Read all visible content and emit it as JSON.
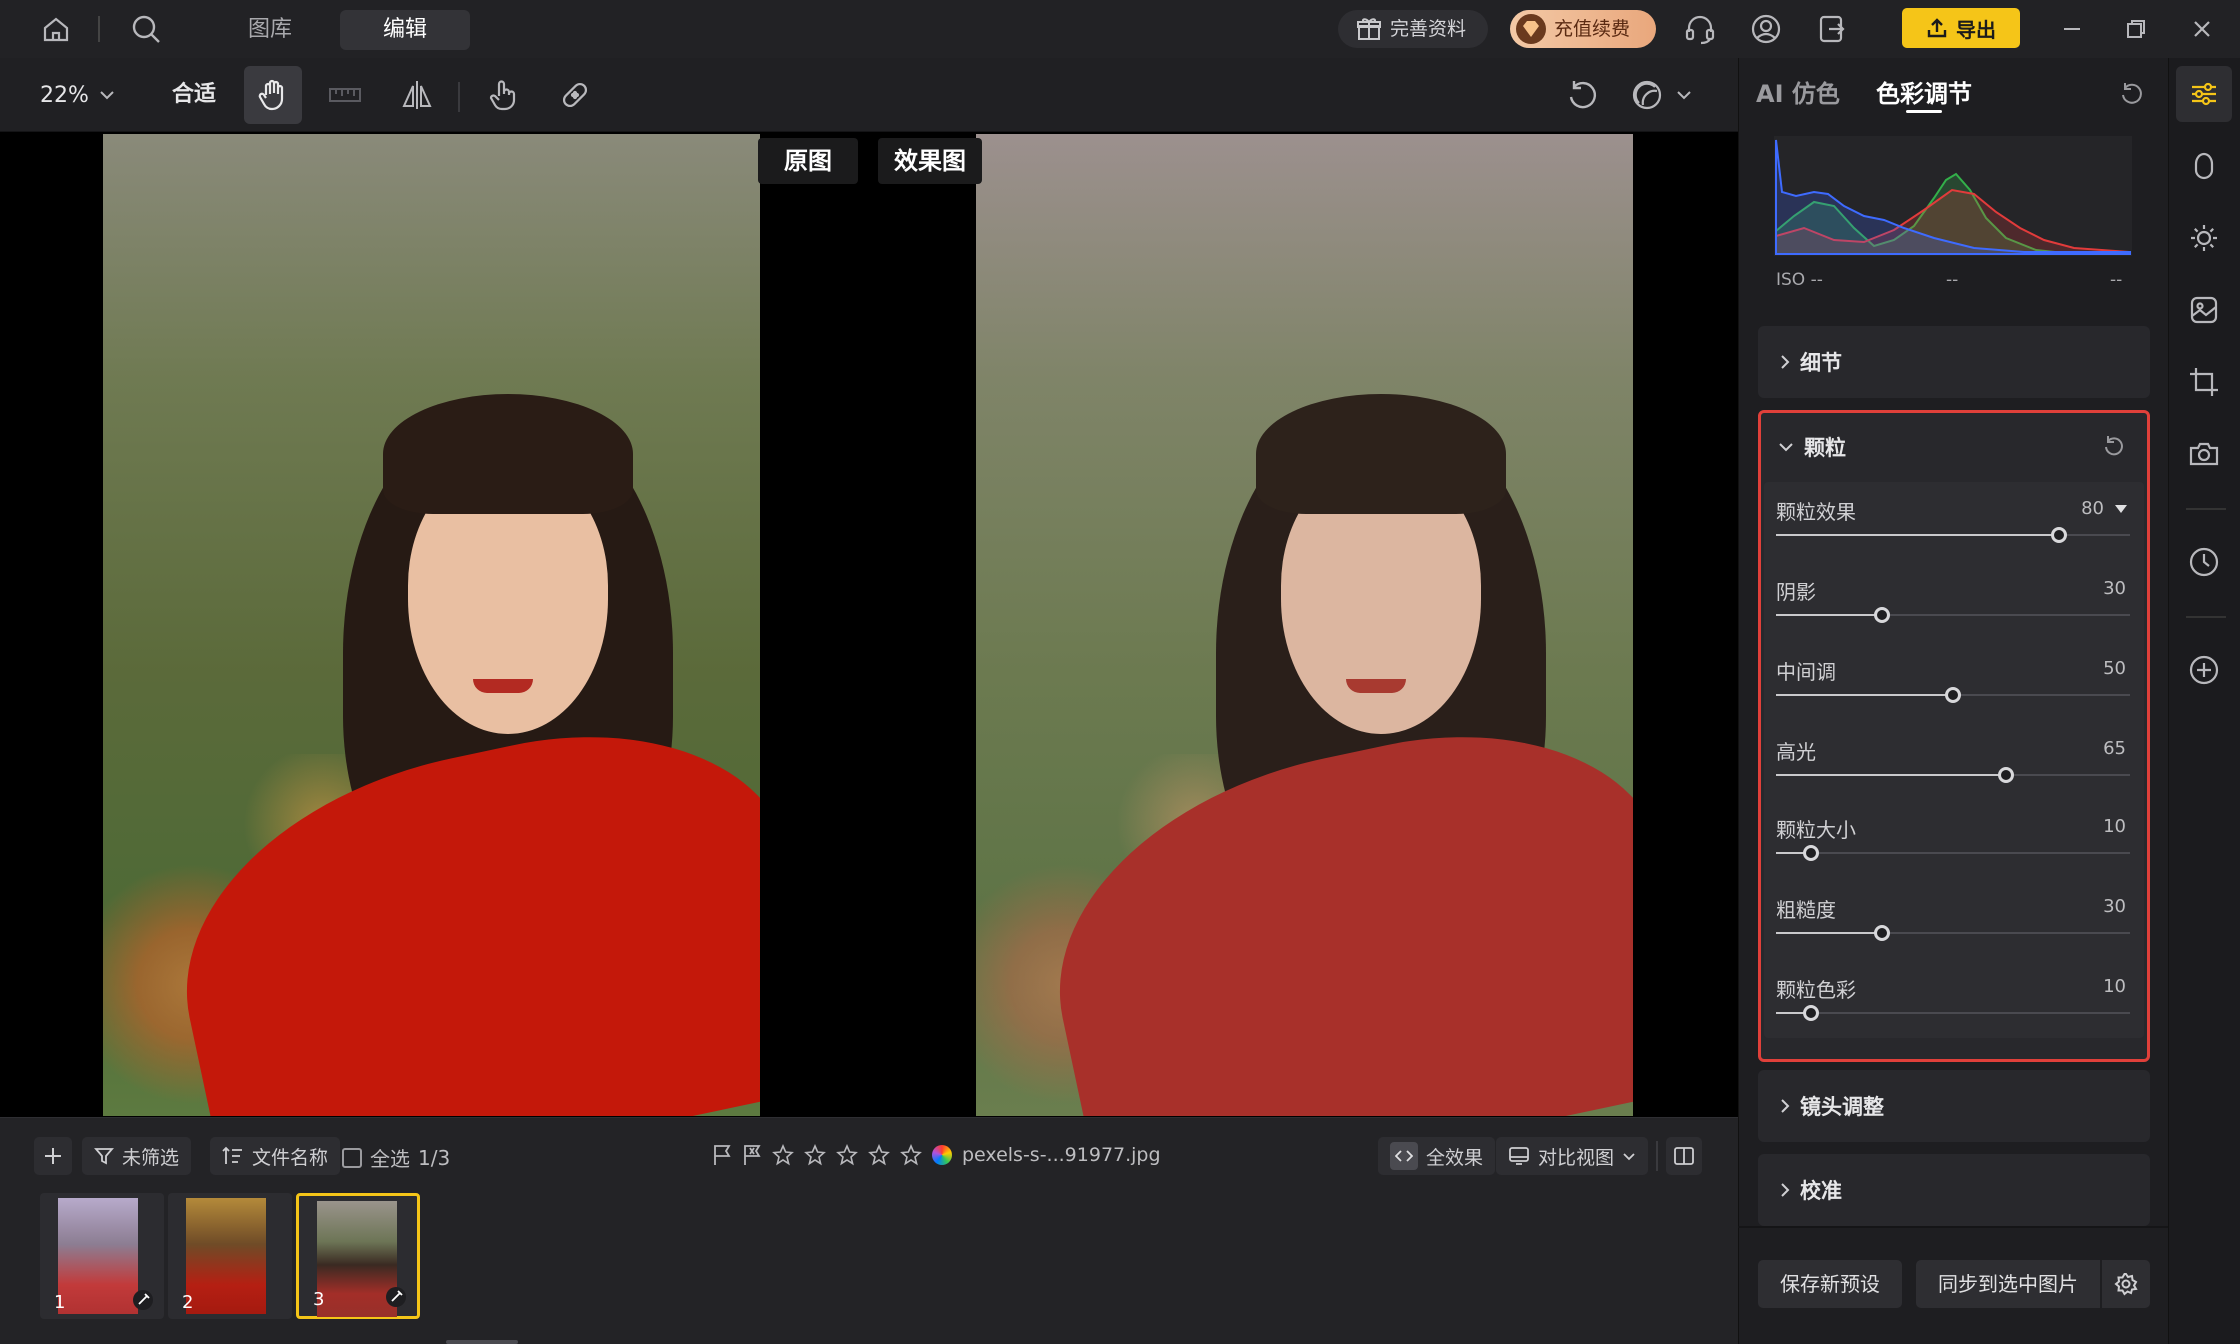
{
  "nav": {
    "tabs": [
      "图库",
      "编辑"
    ],
    "active_tab": "编辑",
    "profile_label": "完善资料",
    "recharge_label": "充值续费",
    "export_label": "导出"
  },
  "toolbar": {
    "zoom": "22%",
    "fit_label": "合适"
  },
  "canvas": {
    "original_label": "原图",
    "effect_label": "效果图"
  },
  "right_panel": {
    "tabs": [
      "AI 仿色",
      "色彩调节"
    ],
    "active_tab": "色彩调节",
    "histogram": {
      "iso": "ISO --",
      "mid": "--",
      "right": "--",
      "colors": {
        "blue": "#3e6bff",
        "red": "#e23b3b",
        "green": "#33b04a"
      }
    },
    "sections": {
      "detail": "细节",
      "grain": "颗粒",
      "lens": "镜头调整",
      "calibration": "校准"
    },
    "grain_sliders": [
      {
        "label": "颗粒效果",
        "value": "80",
        "percent": 80
      },
      {
        "label": "阴影",
        "value": "30",
        "percent": 30
      },
      {
        "label": "中间调",
        "value": "50",
        "percent": 50
      },
      {
        "label": "高光",
        "value": "65",
        "percent": 65
      },
      {
        "label": "颗粒大小",
        "value": "10",
        "percent": 10
      },
      {
        "label": "粗糙度",
        "value": "30",
        "percent": 30
      },
      {
        "label": "颗粒色彩",
        "value": "10",
        "percent": 10
      }
    ],
    "save_preset": "保存新预设",
    "sync_label": "同步到选中图片"
  },
  "bottom": {
    "filter_label": "未筛选",
    "sort_label": "文件名称",
    "select_all": "全选",
    "count": "1/3",
    "filename": "pexels-s-...91977.jpg",
    "all_effects": "全效果",
    "compare_view": "对比视图",
    "thumbnails": [
      "1",
      "2",
      "3"
    ],
    "selected_thumb": "3"
  },
  "colors": {
    "accent_yellow": "#f5c518",
    "highlight_red": "#e0403a"
  }
}
